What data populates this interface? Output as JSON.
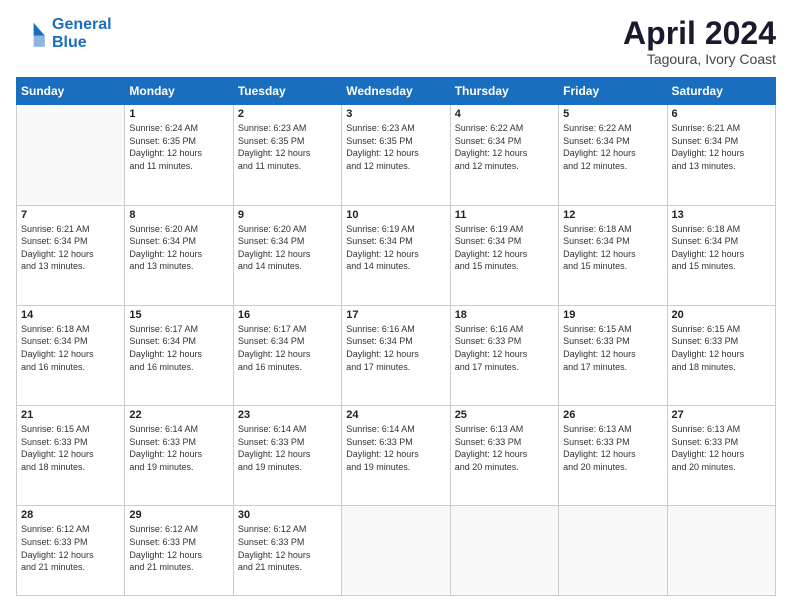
{
  "header": {
    "logo_line1": "General",
    "logo_line2": "Blue",
    "title": "April 2024",
    "subtitle": "Tagoura, Ivory Coast"
  },
  "days_of_week": [
    "Sunday",
    "Monday",
    "Tuesday",
    "Wednesday",
    "Thursday",
    "Friday",
    "Saturday"
  ],
  "weeks": [
    [
      {
        "day": "",
        "info": ""
      },
      {
        "day": "1",
        "info": "Sunrise: 6:24 AM\nSunset: 6:35 PM\nDaylight: 12 hours\nand 11 minutes."
      },
      {
        "day": "2",
        "info": "Sunrise: 6:23 AM\nSunset: 6:35 PM\nDaylight: 12 hours\nand 11 minutes."
      },
      {
        "day": "3",
        "info": "Sunrise: 6:23 AM\nSunset: 6:35 PM\nDaylight: 12 hours\nand 12 minutes."
      },
      {
        "day": "4",
        "info": "Sunrise: 6:22 AM\nSunset: 6:34 PM\nDaylight: 12 hours\nand 12 minutes."
      },
      {
        "day": "5",
        "info": "Sunrise: 6:22 AM\nSunset: 6:34 PM\nDaylight: 12 hours\nand 12 minutes."
      },
      {
        "day": "6",
        "info": "Sunrise: 6:21 AM\nSunset: 6:34 PM\nDaylight: 12 hours\nand 13 minutes."
      }
    ],
    [
      {
        "day": "7",
        "info": "Sunrise: 6:21 AM\nSunset: 6:34 PM\nDaylight: 12 hours\nand 13 minutes."
      },
      {
        "day": "8",
        "info": "Sunrise: 6:20 AM\nSunset: 6:34 PM\nDaylight: 12 hours\nand 13 minutes."
      },
      {
        "day": "9",
        "info": "Sunrise: 6:20 AM\nSunset: 6:34 PM\nDaylight: 12 hours\nand 14 minutes."
      },
      {
        "day": "10",
        "info": "Sunrise: 6:19 AM\nSunset: 6:34 PM\nDaylight: 12 hours\nand 14 minutes."
      },
      {
        "day": "11",
        "info": "Sunrise: 6:19 AM\nSunset: 6:34 PM\nDaylight: 12 hours\nand 15 minutes."
      },
      {
        "day": "12",
        "info": "Sunrise: 6:18 AM\nSunset: 6:34 PM\nDaylight: 12 hours\nand 15 minutes."
      },
      {
        "day": "13",
        "info": "Sunrise: 6:18 AM\nSunset: 6:34 PM\nDaylight: 12 hours\nand 15 minutes."
      }
    ],
    [
      {
        "day": "14",
        "info": "Sunrise: 6:18 AM\nSunset: 6:34 PM\nDaylight: 12 hours\nand 16 minutes."
      },
      {
        "day": "15",
        "info": "Sunrise: 6:17 AM\nSunset: 6:34 PM\nDaylight: 12 hours\nand 16 minutes."
      },
      {
        "day": "16",
        "info": "Sunrise: 6:17 AM\nSunset: 6:34 PM\nDaylight: 12 hours\nand 16 minutes."
      },
      {
        "day": "17",
        "info": "Sunrise: 6:16 AM\nSunset: 6:34 PM\nDaylight: 12 hours\nand 17 minutes."
      },
      {
        "day": "18",
        "info": "Sunrise: 6:16 AM\nSunset: 6:33 PM\nDaylight: 12 hours\nand 17 minutes."
      },
      {
        "day": "19",
        "info": "Sunrise: 6:15 AM\nSunset: 6:33 PM\nDaylight: 12 hours\nand 17 minutes."
      },
      {
        "day": "20",
        "info": "Sunrise: 6:15 AM\nSunset: 6:33 PM\nDaylight: 12 hours\nand 18 minutes."
      }
    ],
    [
      {
        "day": "21",
        "info": "Sunrise: 6:15 AM\nSunset: 6:33 PM\nDaylight: 12 hours\nand 18 minutes."
      },
      {
        "day": "22",
        "info": "Sunrise: 6:14 AM\nSunset: 6:33 PM\nDaylight: 12 hours\nand 19 minutes."
      },
      {
        "day": "23",
        "info": "Sunrise: 6:14 AM\nSunset: 6:33 PM\nDaylight: 12 hours\nand 19 minutes."
      },
      {
        "day": "24",
        "info": "Sunrise: 6:14 AM\nSunset: 6:33 PM\nDaylight: 12 hours\nand 19 minutes."
      },
      {
        "day": "25",
        "info": "Sunrise: 6:13 AM\nSunset: 6:33 PM\nDaylight: 12 hours\nand 20 minutes."
      },
      {
        "day": "26",
        "info": "Sunrise: 6:13 AM\nSunset: 6:33 PM\nDaylight: 12 hours\nand 20 minutes."
      },
      {
        "day": "27",
        "info": "Sunrise: 6:13 AM\nSunset: 6:33 PM\nDaylight: 12 hours\nand 20 minutes."
      }
    ],
    [
      {
        "day": "28",
        "info": "Sunrise: 6:12 AM\nSunset: 6:33 PM\nDaylight: 12 hours\nand 21 minutes."
      },
      {
        "day": "29",
        "info": "Sunrise: 6:12 AM\nSunset: 6:33 PM\nDaylight: 12 hours\nand 21 minutes."
      },
      {
        "day": "30",
        "info": "Sunrise: 6:12 AM\nSunset: 6:33 PM\nDaylight: 12 hours\nand 21 minutes."
      },
      {
        "day": "",
        "info": ""
      },
      {
        "day": "",
        "info": ""
      },
      {
        "day": "",
        "info": ""
      },
      {
        "day": "",
        "info": ""
      }
    ]
  ]
}
